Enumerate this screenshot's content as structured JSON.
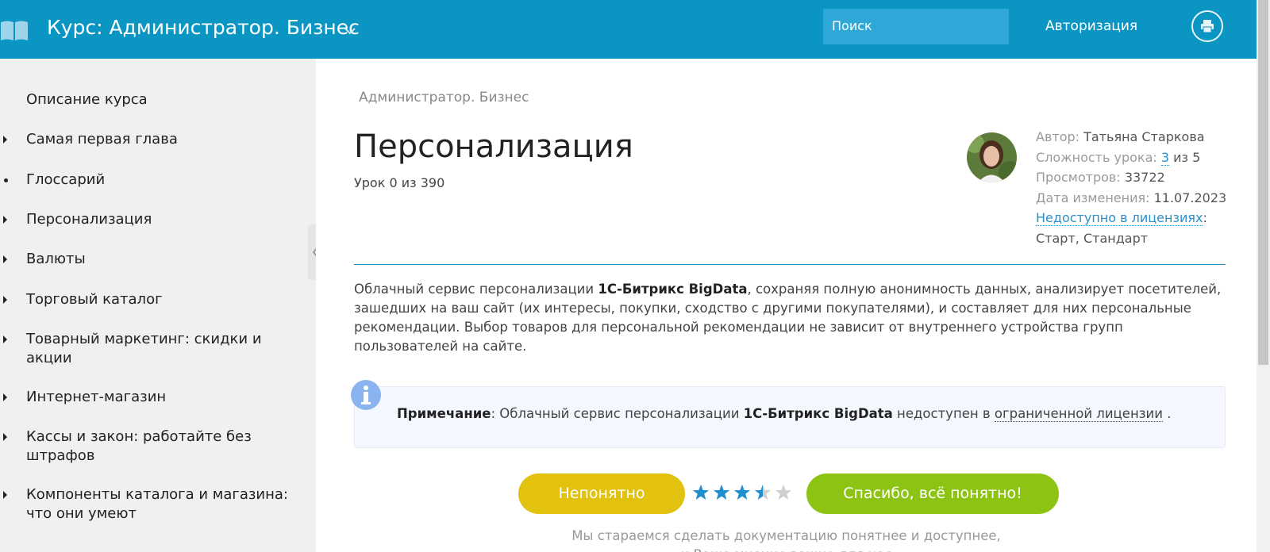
{
  "header": {
    "course_title": "Курс: Администратор. Бизнес",
    "search_placeholder": "Поиск",
    "auth_label": "Авторизация",
    "logo_icon": "book-icon",
    "print_icon": "printer-icon",
    "color": "#0a95c2"
  },
  "sidebar": {
    "items": [
      {
        "label": "Описание курса",
        "marker": "none"
      },
      {
        "label": "Самая первая глава",
        "marker": "triangle"
      },
      {
        "label": "Глоссарий",
        "marker": "dot"
      },
      {
        "label": "Персонализация",
        "marker": "triangle"
      },
      {
        "label": "Валюты",
        "marker": "triangle"
      },
      {
        "label": "Торговый каталог",
        "marker": "triangle"
      },
      {
        "label": "Товарный маркетинг: скидки и акции",
        "marker": "triangle"
      },
      {
        "label": "Интернет-магазин",
        "marker": "triangle"
      },
      {
        "label": "Кассы и закон: работайте без штрафов",
        "marker": "triangle"
      },
      {
        "label": "Компоненты каталога и магазина: что они умеют",
        "marker": "triangle"
      }
    ]
  },
  "main": {
    "breadcrumb": "Администратор. Бизнес",
    "title": "Персонализация",
    "lesson_number": "Урок 0 из 390",
    "meta": {
      "author_label": "Автор:",
      "author": "Татьяна Старкова",
      "difficulty_label": "Сложность урока:",
      "difficulty_value": "3",
      "difficulty_suffix": "из 5",
      "views_label": "Просмотров:",
      "views": "33722",
      "modified_label": "Дата изменения:",
      "modified": "11.07.2023",
      "licenses_link": "Недоступно в лицензиях",
      "licenses": "Старт, Стандарт"
    },
    "body": {
      "part1": "Облачный сервис персонализации ",
      "bold": "1С-Битрикс BigData",
      "part2": ", сохраняя полную анонимность данных, анализирует посетителей, зашедших на ваш сайт (их интересы, покупки, сходство с другими покупателями), и составляет для них персональные рекомендации. Выбор товаров для персональной рекомендации не зависит от внутреннего устройства групп пользователей на сайте."
    },
    "note": {
      "label": "Примечание",
      "part1": ": Облачный сервис персонализации ",
      "bold": "1С-Битрикс BigData",
      "part2": " недоступен в ",
      "link": "ограниченной лицензии",
      "part3": " ."
    },
    "feedback": {
      "unclear_label": "Непонятно",
      "thanks_label": "Спасибо, всё понятно!",
      "rating": 3.5,
      "rating_max": 5,
      "line1": "Мы стараемся сделать документацию понятнее и доступнее,",
      "line2": "и Ваше мнение важно для нас"
    }
  },
  "colors": {
    "accent": "#0a95c2",
    "link": "#2d8fc9",
    "star": "#1f8fd0",
    "unclear_button": "#e2c20e",
    "thanks_button": "#8dc414"
  }
}
